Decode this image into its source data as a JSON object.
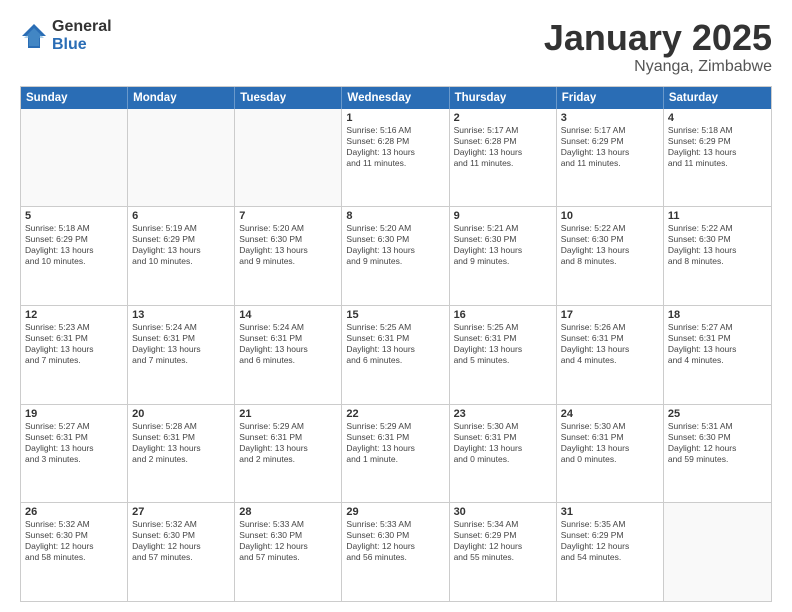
{
  "logo": {
    "general": "General",
    "blue": "Blue"
  },
  "title": {
    "month": "January 2025",
    "location": "Nyanga, Zimbabwe"
  },
  "days_of_week": [
    "Sunday",
    "Monday",
    "Tuesday",
    "Wednesday",
    "Thursday",
    "Friday",
    "Saturday"
  ],
  "weeks": [
    [
      {
        "day": "",
        "info": ""
      },
      {
        "day": "",
        "info": ""
      },
      {
        "day": "",
        "info": ""
      },
      {
        "day": "1",
        "info": "Sunrise: 5:16 AM\nSunset: 6:28 PM\nDaylight: 13 hours\nand 11 minutes."
      },
      {
        "day": "2",
        "info": "Sunrise: 5:17 AM\nSunset: 6:28 PM\nDaylight: 13 hours\nand 11 minutes."
      },
      {
        "day": "3",
        "info": "Sunrise: 5:17 AM\nSunset: 6:29 PM\nDaylight: 13 hours\nand 11 minutes."
      },
      {
        "day": "4",
        "info": "Sunrise: 5:18 AM\nSunset: 6:29 PM\nDaylight: 13 hours\nand 11 minutes."
      }
    ],
    [
      {
        "day": "5",
        "info": "Sunrise: 5:18 AM\nSunset: 6:29 PM\nDaylight: 13 hours\nand 10 minutes."
      },
      {
        "day": "6",
        "info": "Sunrise: 5:19 AM\nSunset: 6:29 PM\nDaylight: 13 hours\nand 10 minutes."
      },
      {
        "day": "7",
        "info": "Sunrise: 5:20 AM\nSunset: 6:30 PM\nDaylight: 13 hours\nand 9 minutes."
      },
      {
        "day": "8",
        "info": "Sunrise: 5:20 AM\nSunset: 6:30 PM\nDaylight: 13 hours\nand 9 minutes."
      },
      {
        "day": "9",
        "info": "Sunrise: 5:21 AM\nSunset: 6:30 PM\nDaylight: 13 hours\nand 9 minutes."
      },
      {
        "day": "10",
        "info": "Sunrise: 5:22 AM\nSunset: 6:30 PM\nDaylight: 13 hours\nand 8 minutes."
      },
      {
        "day": "11",
        "info": "Sunrise: 5:22 AM\nSunset: 6:30 PM\nDaylight: 13 hours\nand 8 minutes."
      }
    ],
    [
      {
        "day": "12",
        "info": "Sunrise: 5:23 AM\nSunset: 6:31 PM\nDaylight: 13 hours\nand 7 minutes."
      },
      {
        "day": "13",
        "info": "Sunrise: 5:24 AM\nSunset: 6:31 PM\nDaylight: 13 hours\nand 7 minutes."
      },
      {
        "day": "14",
        "info": "Sunrise: 5:24 AM\nSunset: 6:31 PM\nDaylight: 13 hours\nand 6 minutes."
      },
      {
        "day": "15",
        "info": "Sunrise: 5:25 AM\nSunset: 6:31 PM\nDaylight: 13 hours\nand 6 minutes."
      },
      {
        "day": "16",
        "info": "Sunrise: 5:25 AM\nSunset: 6:31 PM\nDaylight: 13 hours\nand 5 minutes."
      },
      {
        "day": "17",
        "info": "Sunrise: 5:26 AM\nSunset: 6:31 PM\nDaylight: 13 hours\nand 4 minutes."
      },
      {
        "day": "18",
        "info": "Sunrise: 5:27 AM\nSunset: 6:31 PM\nDaylight: 13 hours\nand 4 minutes."
      }
    ],
    [
      {
        "day": "19",
        "info": "Sunrise: 5:27 AM\nSunset: 6:31 PM\nDaylight: 13 hours\nand 3 minutes."
      },
      {
        "day": "20",
        "info": "Sunrise: 5:28 AM\nSunset: 6:31 PM\nDaylight: 13 hours\nand 2 minutes."
      },
      {
        "day": "21",
        "info": "Sunrise: 5:29 AM\nSunset: 6:31 PM\nDaylight: 13 hours\nand 2 minutes."
      },
      {
        "day": "22",
        "info": "Sunrise: 5:29 AM\nSunset: 6:31 PM\nDaylight: 13 hours\nand 1 minute."
      },
      {
        "day": "23",
        "info": "Sunrise: 5:30 AM\nSunset: 6:31 PM\nDaylight: 13 hours\nand 0 minutes."
      },
      {
        "day": "24",
        "info": "Sunrise: 5:30 AM\nSunset: 6:31 PM\nDaylight: 13 hours\nand 0 minutes."
      },
      {
        "day": "25",
        "info": "Sunrise: 5:31 AM\nSunset: 6:30 PM\nDaylight: 12 hours\nand 59 minutes."
      }
    ],
    [
      {
        "day": "26",
        "info": "Sunrise: 5:32 AM\nSunset: 6:30 PM\nDaylight: 12 hours\nand 58 minutes."
      },
      {
        "day": "27",
        "info": "Sunrise: 5:32 AM\nSunset: 6:30 PM\nDaylight: 12 hours\nand 57 minutes."
      },
      {
        "day": "28",
        "info": "Sunrise: 5:33 AM\nSunset: 6:30 PM\nDaylight: 12 hours\nand 57 minutes."
      },
      {
        "day": "29",
        "info": "Sunrise: 5:33 AM\nSunset: 6:30 PM\nDaylight: 12 hours\nand 56 minutes."
      },
      {
        "day": "30",
        "info": "Sunrise: 5:34 AM\nSunset: 6:29 PM\nDaylight: 12 hours\nand 55 minutes."
      },
      {
        "day": "31",
        "info": "Sunrise: 5:35 AM\nSunset: 6:29 PM\nDaylight: 12 hours\nand 54 minutes."
      },
      {
        "day": "",
        "info": ""
      }
    ]
  ]
}
